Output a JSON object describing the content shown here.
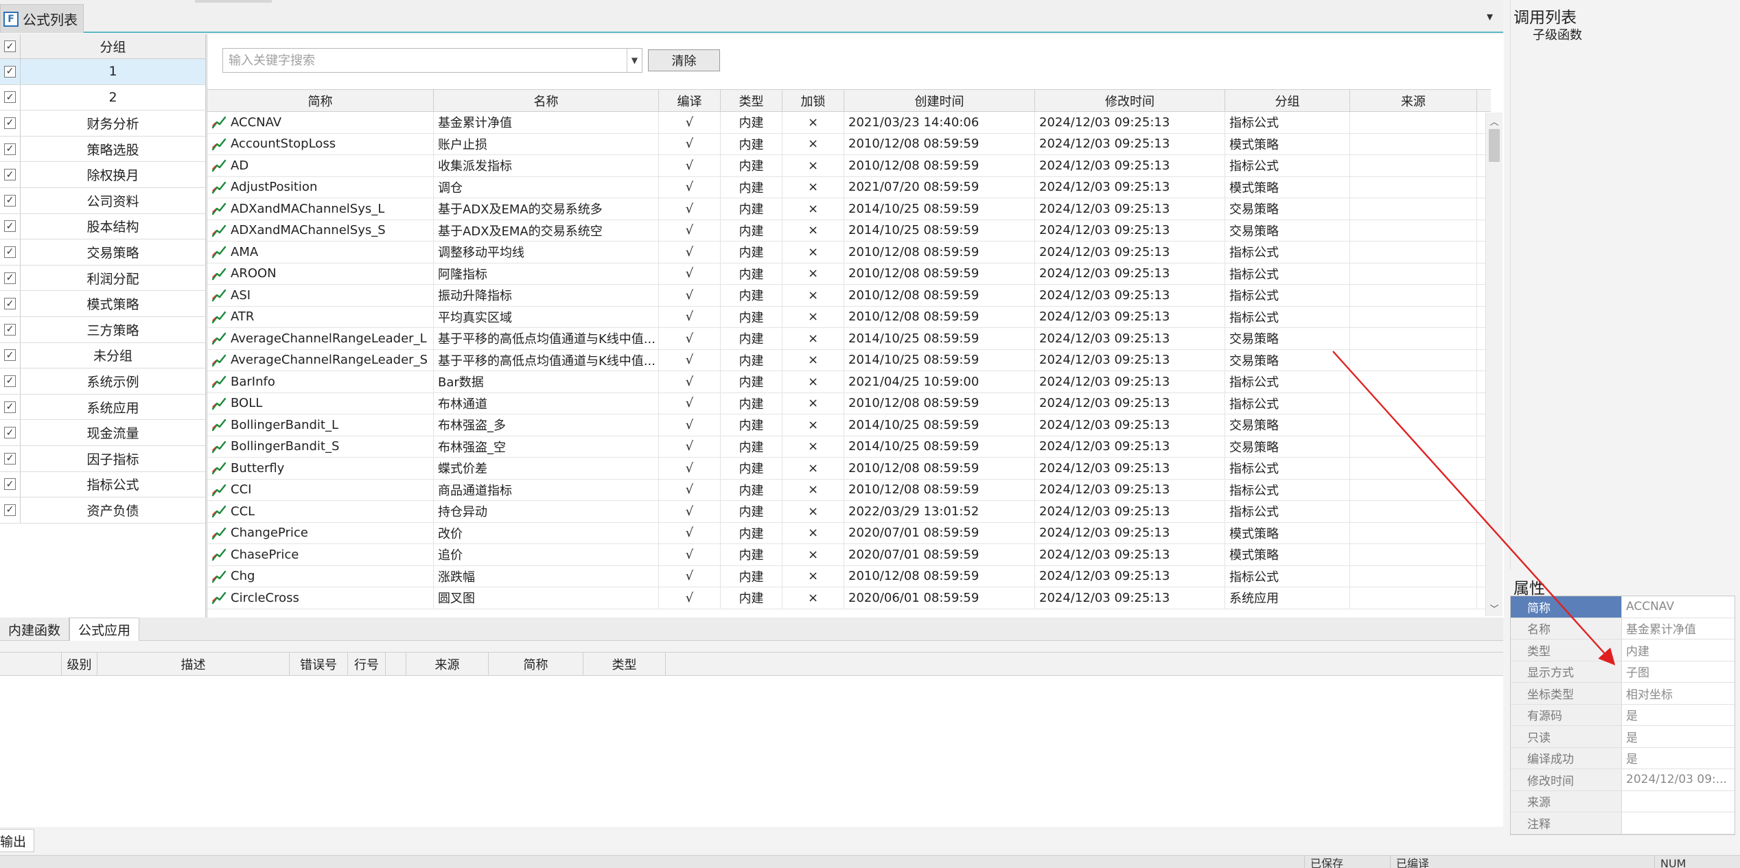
{
  "top_tab": {
    "icon_letter": "F",
    "label": "公式列表"
  },
  "top_dropdown_glyph": "▾",
  "group_panel": {
    "header": "分组",
    "items": [
      "1",
      "2",
      "财务分析",
      "策略选股",
      "除权换月",
      "公司资料",
      "股本结构",
      "交易策略",
      "利润分配",
      "模式策略",
      "三方策略",
      "未分组",
      "系统示例",
      "系统应用",
      "现金流量",
      "因子指标",
      "指标公式",
      "资产负债"
    ],
    "selected_index": 0
  },
  "search": {
    "placeholder": "输入关键字搜索",
    "clear_label": "清除"
  },
  "table": {
    "columns": [
      "简称",
      "名称",
      "编译",
      "类型",
      "加锁",
      "创建时间",
      "修改时间",
      "分组",
      "来源"
    ],
    "rows": [
      [
        "ACCNAV",
        "基金累计净值",
        "√",
        "内建",
        "×",
        "2021/03/23 14:40:06",
        "2024/12/03 09:25:13",
        "指标公式",
        ""
      ],
      [
        "AccountStopLoss",
        "账户止损",
        "√",
        "内建",
        "×",
        "2010/12/08 08:59:59",
        "2024/12/03 09:25:13",
        "模式策略",
        ""
      ],
      [
        "AD",
        "收集派发指标",
        "√",
        "内建",
        "×",
        "2010/12/08 08:59:59",
        "2024/12/03 09:25:13",
        "指标公式",
        ""
      ],
      [
        "AdjustPosition",
        "调仓",
        "√",
        "内建",
        "×",
        "2021/07/20 08:59:59",
        "2024/12/03 09:25:13",
        "模式策略",
        ""
      ],
      [
        "ADXandMAChannelSys_L",
        "基于ADX及EMA的交易系统多",
        "√",
        "内建",
        "×",
        "2014/10/25 08:59:59",
        "2024/12/03 09:25:13",
        "交易策略",
        ""
      ],
      [
        "ADXandMAChannelSys_S",
        "基于ADX及EMA的交易系统空",
        "√",
        "内建",
        "×",
        "2014/10/25 08:59:59",
        "2024/12/03 09:25:13",
        "交易策略",
        ""
      ],
      [
        "AMA",
        "调整移动平均线",
        "√",
        "内建",
        "×",
        "2010/12/08 08:59:59",
        "2024/12/03 09:25:13",
        "指标公式",
        ""
      ],
      [
        "AROON",
        "阿隆指标",
        "√",
        "内建",
        "×",
        "2010/12/08 08:59:59",
        "2024/12/03 09:25:13",
        "指标公式",
        ""
      ],
      [
        "ASI",
        "振动升降指标",
        "√",
        "内建",
        "×",
        "2010/12/08 08:59:59",
        "2024/12/03 09:25:13",
        "指标公式",
        ""
      ],
      [
        "ATR",
        "平均真实区域",
        "√",
        "内建",
        "×",
        "2010/12/08 08:59:59",
        "2024/12/03 09:25:13",
        "指标公式",
        ""
      ],
      [
        "AverageChannelRangeLeader_L",
        "基于平移的高低点均值通道与K线中值...",
        "√",
        "内建",
        "×",
        "2014/10/25 08:59:59",
        "2024/12/03 09:25:13",
        "交易策略",
        ""
      ],
      [
        "AverageChannelRangeLeader_S",
        "基于平移的高低点均值通道与K线中值...",
        "√",
        "内建",
        "×",
        "2014/10/25 08:59:59",
        "2024/12/03 09:25:13",
        "交易策略",
        ""
      ],
      [
        "BarInfo",
        "Bar数据",
        "√",
        "内建",
        "×",
        "2021/04/25 10:59:00",
        "2024/12/03 09:25:13",
        "指标公式",
        ""
      ],
      [
        "BOLL",
        "布林通道",
        "√",
        "内建",
        "×",
        "2010/12/08 08:59:59",
        "2024/12/03 09:25:13",
        "指标公式",
        ""
      ],
      [
        "BollingerBandit_L",
        "布林强盗_多",
        "√",
        "内建",
        "×",
        "2014/10/25 08:59:59",
        "2024/12/03 09:25:13",
        "交易策略",
        ""
      ],
      [
        "BollingerBandit_S",
        "布林强盗_空",
        "√",
        "内建",
        "×",
        "2014/10/25 08:59:59",
        "2024/12/03 09:25:13",
        "交易策略",
        ""
      ],
      [
        "Butterfly",
        "蝶式价差",
        "√",
        "内建",
        "×",
        "2010/12/08 08:59:59",
        "2024/12/03 09:25:13",
        "指标公式",
        ""
      ],
      [
        "CCI",
        "商品通道指标",
        "√",
        "内建",
        "×",
        "2010/12/08 08:59:59",
        "2024/12/03 09:25:13",
        "指标公式",
        ""
      ],
      [
        "CCL",
        "持仓异动",
        "√",
        "内建",
        "×",
        "2022/03/29 13:01:52",
        "2024/12/03 09:25:13",
        "指标公式",
        ""
      ],
      [
        "ChangePrice",
        "改价",
        "√",
        "内建",
        "×",
        "2020/07/01 08:59:59",
        "2024/12/03 09:25:13",
        "模式策略",
        ""
      ],
      [
        "ChasePrice",
        "追价",
        "√",
        "内建",
        "×",
        "2020/07/01 08:59:59",
        "2024/12/03 09:25:13",
        "模式策略",
        ""
      ],
      [
        "Chg",
        "涨跌幅",
        "√",
        "内建",
        "×",
        "2010/12/08 08:59:59",
        "2024/12/03 09:25:13",
        "指标公式",
        ""
      ],
      [
        "CircleCross",
        "圆叉图",
        "√",
        "内建",
        "×",
        "2020/06/01 08:59:59",
        "2024/12/03 09:25:13",
        "系统应用",
        ""
      ]
    ]
  },
  "bottom_tabs": [
    "内建函数",
    "公式应用"
  ],
  "bottom_tab_active": 1,
  "output": {
    "columns": [
      "级别",
      "描述",
      "错误号",
      "行号",
      "来源",
      "简称",
      "类型"
    ],
    "tab_label": "输出"
  },
  "call_list": {
    "title": "调用列表",
    "items": [
      "子级函数"
    ]
  },
  "properties": {
    "title": "属性",
    "rows": [
      {
        "key": "简称",
        "value": "ACCNAV"
      },
      {
        "key": "名称",
        "value": "基金累计净值"
      },
      {
        "key": "类型",
        "value": "内建"
      },
      {
        "key": "显示方式",
        "value": "子图"
      },
      {
        "key": "坐标类型",
        "value": "相对坐标"
      },
      {
        "key": "有源码",
        "value": "是"
      },
      {
        "key": "只读",
        "value": "是"
      },
      {
        "key": "编译成功",
        "value": "是"
      },
      {
        "key": "修改时间",
        "value": "2024/12/03 09:..."
      },
      {
        "key": "来源",
        "value": ""
      },
      {
        "key": "注释",
        "value": ""
      }
    ]
  },
  "status_bar": {
    "items": [
      "已保存",
      "已编译",
      "NUM"
    ]
  },
  "colors": {
    "accent_line": "#5fb7c4",
    "selection": "#dceefa",
    "prop_selected": "#5b7fb9",
    "annotation_arrow": "#e02020",
    "icon_green": "#1a8a3a"
  }
}
